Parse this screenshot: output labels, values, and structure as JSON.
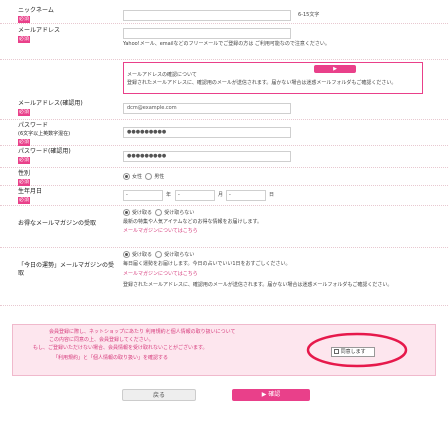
{
  "colors": {
    "accent": "#e9408a",
    "pink_text": "#d63a7c",
    "highlight": "#e6194b"
  },
  "fields": {
    "nickname": {
      "label": "ニックネーム",
      "req": "必須",
      "value": "",
      "hint": "6-15文字"
    },
    "email": {
      "label": "メールアドレス",
      "req": "必須",
      "value": "",
      "note": "Yahoo!メール、emailなどのフリーメールでご登録の方は ご利用可能なので注意ください。"
    },
    "email_confirm": {
      "label": "メールアドレス(確認用)",
      "req": "必須",
      "value": "dcm@example.com"
    },
    "password": {
      "label": "パスワード",
      "sub": "(6文字以上英数字混在)",
      "req": "必須",
      "value": "●●●●●●●●●"
    },
    "password_confirm": {
      "label": "パスワード(確認用)",
      "req": "必須",
      "value": "●●●●●●●●●"
    },
    "gender": {
      "label": "性別",
      "req": "必須",
      "options": [
        "女性",
        "男性"
      ],
      "selected": 0
    },
    "birthday": {
      "label": "生年月日",
      "req": "必須",
      "year": "-",
      "year_unit": "年",
      "month": "-",
      "month_unit": "月",
      "day": "-",
      "day_unit": "日"
    },
    "mail_setting": {
      "label": "お得なメールマガジンの受取",
      "options": [
        "受け取る",
        "受け取らない"
      ],
      "selected": 0,
      "note": "最新の特集や人気アイテムなどのお得な情報をお届けします。",
      "link": "メールマガジンについてはこちら"
    },
    "notice": {
      "label": "「今日の運勢」メールマガジンの受取",
      "options": [
        "受け取る",
        "受け取らない"
      ],
      "selected": 0,
      "note": "毎日届く運勢をお届けします。今日の占いでいい1日をおすごしください。",
      "link": "メールマガジンについてはこちら"
    }
  },
  "info_box": {
    "title": "メールアドレスの確認について",
    "text": "登録されたメールアドレスに、確認用のメールが送信されます。届かない場合は迷惑メールフォルダもご確認ください。"
  },
  "agree_box": {
    "line1": "会員登録に際し、ネットショップにあたり 利用規約と個人情報の取り扱いについて",
    "line2": "この内容に同意の上、会員登録してください。",
    "line3": "もし、ご登録いただけない場合、会員情報を受け取れないことがございます。",
    "link": "「利用規約」と「個人情報の取り扱い」を確認する",
    "checkbox_label": "同意します",
    "checked": false
  },
  "buttons": {
    "back": "戻る",
    "confirm": "確認"
  }
}
